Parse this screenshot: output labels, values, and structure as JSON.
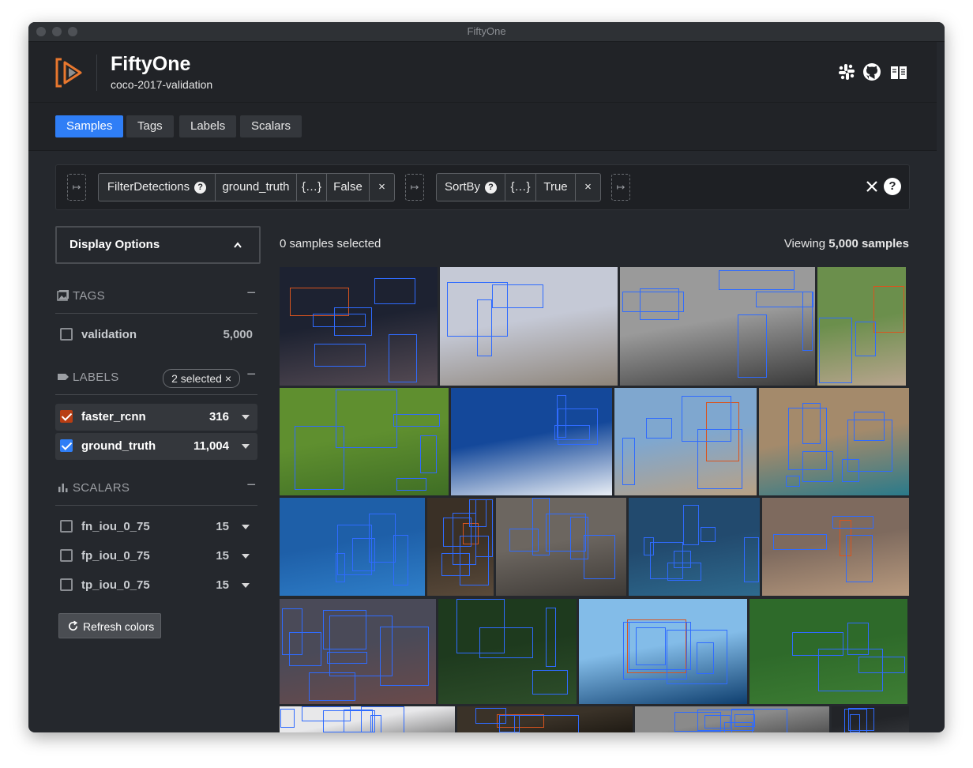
{
  "window": {
    "title": "FiftyOne"
  },
  "header": {
    "title": "FiftyOne",
    "dataset": "coco-2017-validation",
    "icons": [
      "slack-icon",
      "github-icon",
      "docs-book-icon"
    ]
  },
  "tabs": [
    {
      "label": "Samples",
      "active": true
    },
    {
      "label": "Tags",
      "active": false
    },
    {
      "label": "Labels",
      "active": false
    },
    {
      "label": "Scalars",
      "active": false
    }
  ],
  "view_bar": {
    "stages": [
      {
        "name": "FilterDetections",
        "params": [
          "ground_truth",
          "{…}",
          "False"
        ]
      },
      {
        "name": "SortBy",
        "params": [
          "{…}",
          "True"
        ]
      }
    ],
    "add_stage_glyph": "↦",
    "remove_glyph": "×"
  },
  "sidebar": {
    "display_options": "Display Options",
    "tags": {
      "title": "TAGS",
      "items": [
        {
          "name": "validation",
          "count": "5,000",
          "checked": false
        }
      ]
    },
    "labels": {
      "title": "LABELS",
      "selected_pill": "2 selected ×",
      "items": [
        {
          "name": "faster_rcnn",
          "count": "316",
          "checked": true,
          "color": "#b83d12"
        },
        {
          "name": "ground_truth",
          "count": "11,004",
          "checked": true,
          "color": "#2f7ef6"
        }
      ]
    },
    "scalars": {
      "title": "SCALARS",
      "items": [
        {
          "name": "fn_iou_0_75",
          "count": "15",
          "checked": false
        },
        {
          "name": "fp_iou_0_75",
          "count": "15",
          "checked": false
        },
        {
          "name": "tp_iou_0_75",
          "count": "15",
          "checked": false
        }
      ]
    },
    "refresh_label": "Refresh colors"
  },
  "grid": {
    "selected_text": "0 samples selected",
    "viewing_prefix": "Viewing",
    "viewing_count": "5,000 samples",
    "tiles": [
      {
        "name": "crowd-ribbon-cutting",
        "colors": [
          "#1d2231",
          "#564b54"
        ]
      },
      {
        "name": "kites-on-beach",
        "colors": [
          "#c5c9d6",
          "#8d8479"
        ]
      },
      {
        "name": "school-class-photo",
        "colors": [
          "#9a9a9a",
          "#3a3a3a"
        ]
      },
      {
        "name": "baseball-kids",
        "colors": [
          "#6b8f4c",
          "#b8a48e"
        ]
      },
      {
        "name": "kite-on-grass",
        "colors": [
          "#5f8f2f",
          "#3f6e25"
        ]
      },
      {
        "name": "ski-jump",
        "colors": [
          "#14489a",
          "#e9eef5"
        ]
      },
      {
        "name": "beach-kite-surfer",
        "colors": [
          "#7fa7cf",
          "#b9a184"
        ]
      },
      {
        "name": "indoor-court",
        "colors": [
          "#a48a6b",
          "#2a7a8a"
        ]
      },
      {
        "name": "tennis-blue-court",
        "colors": [
          "#1e5fa8",
          "#2f7fc9"
        ]
      },
      {
        "name": "baseball-crowd",
        "colors": [
          "#3a3026",
          "#5a4a3a"
        ]
      },
      {
        "name": "woman-kitchen",
        "colors": [
          "#6c6660",
          "#3e3a36"
        ]
      },
      {
        "name": "tennis-match",
        "colors": [
          "#224a6e",
          "#2e6a8e"
        ]
      },
      {
        "name": "family-dinner",
        "colors": [
          "#7e6a5e",
          "#b89a7e"
        ]
      },
      {
        "name": "street-crowd",
        "colors": [
          "#4a4a58",
          "#6a4a4a"
        ]
      },
      {
        "name": "grass-tennis",
        "colors": [
          "#1e3a1e",
          "#2e4e2a"
        ]
      },
      {
        "name": "beach-horizon",
        "colors": [
          "#83bce8",
          "#0f3f6f"
        ]
      },
      {
        "name": "soccer-field",
        "colors": [
          "#2e6a2a",
          "#3e7e34"
        ]
      },
      {
        "name": "building-sky",
        "colors": [
          "#e8e8ea",
          "#7a7a7a"
        ]
      },
      {
        "name": "warehouse",
        "colors": [
          "#3a3228",
          "#1a1610"
        ]
      },
      {
        "name": "bw-group",
        "colors": [
          "#8a8a8a",
          "#4a4a4a"
        ]
      },
      {
        "name": "dark-scene",
        "colors": [
          "#222428",
          "#34363a"
        ]
      }
    ]
  }
}
